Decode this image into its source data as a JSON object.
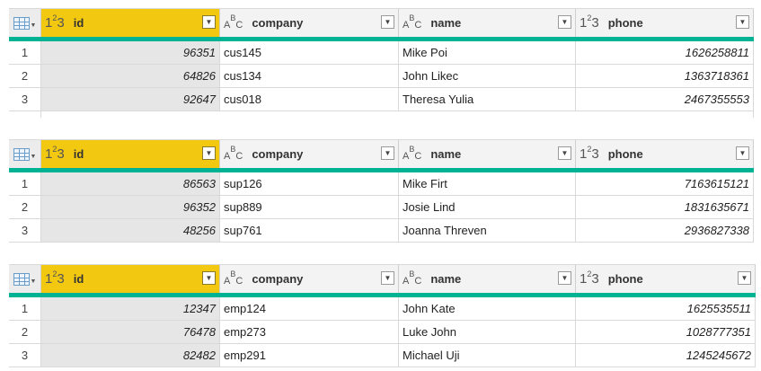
{
  "tables": [
    {
      "columns": [
        {
          "type": "123",
          "label": "id"
        },
        {
          "type": "ABC",
          "label": "company"
        },
        {
          "type": "ABC",
          "label": "name"
        },
        {
          "type": "123",
          "label": "phone"
        }
      ],
      "rows": [
        {
          "num": "1",
          "id": "96351",
          "company": "cus145",
          "name": "Mike Poi",
          "phone": "1626258811"
        },
        {
          "num": "2",
          "id": "64826",
          "company": "cus134",
          "name": "John Likec",
          "phone": "1363718361"
        },
        {
          "num": "3",
          "id": "92647",
          "company": "cus018",
          "name": "Theresa Yulia",
          "phone": "2467355553"
        }
      ]
    },
    {
      "columns": [
        {
          "type": "123",
          "label": "id"
        },
        {
          "type": "ABC",
          "label": "company"
        },
        {
          "type": "ABC",
          "label": "name"
        },
        {
          "type": "123",
          "label": "phone"
        }
      ],
      "rows": [
        {
          "num": "1",
          "id": "86563",
          "company": "sup126",
          "name": "Mike Firt",
          "phone": "7163615121"
        },
        {
          "num": "2",
          "id": "96352",
          "company": "sup889",
          "name": "Josie Lind",
          "phone": "1831635671"
        },
        {
          "num": "3",
          "id": "48256",
          "company": "sup761",
          "name": "Joanna Threven",
          "phone": "2936827338"
        }
      ]
    },
    {
      "columns": [
        {
          "type": "123",
          "label": "id"
        },
        {
          "type": "ABC",
          "label": "company"
        },
        {
          "type": "ABC",
          "label": "name"
        },
        {
          "type": "123",
          "label": "phone"
        }
      ],
      "rows": [
        {
          "num": "1",
          "id": "12347",
          "company": "emp124",
          "name": "John Kate",
          "phone": "1625535511"
        },
        {
          "num": "2",
          "id": "76478",
          "company": "emp273",
          "name": "Luke John",
          "phone": "1028777351"
        },
        {
          "num": "3",
          "id": "82482",
          "company": "emp291",
          "name": "Michael Uji",
          "phone": "1245245672"
        }
      ]
    }
  ],
  "colors": {
    "selected_header": "#f2c811",
    "accent_bar": "#00b294"
  }
}
